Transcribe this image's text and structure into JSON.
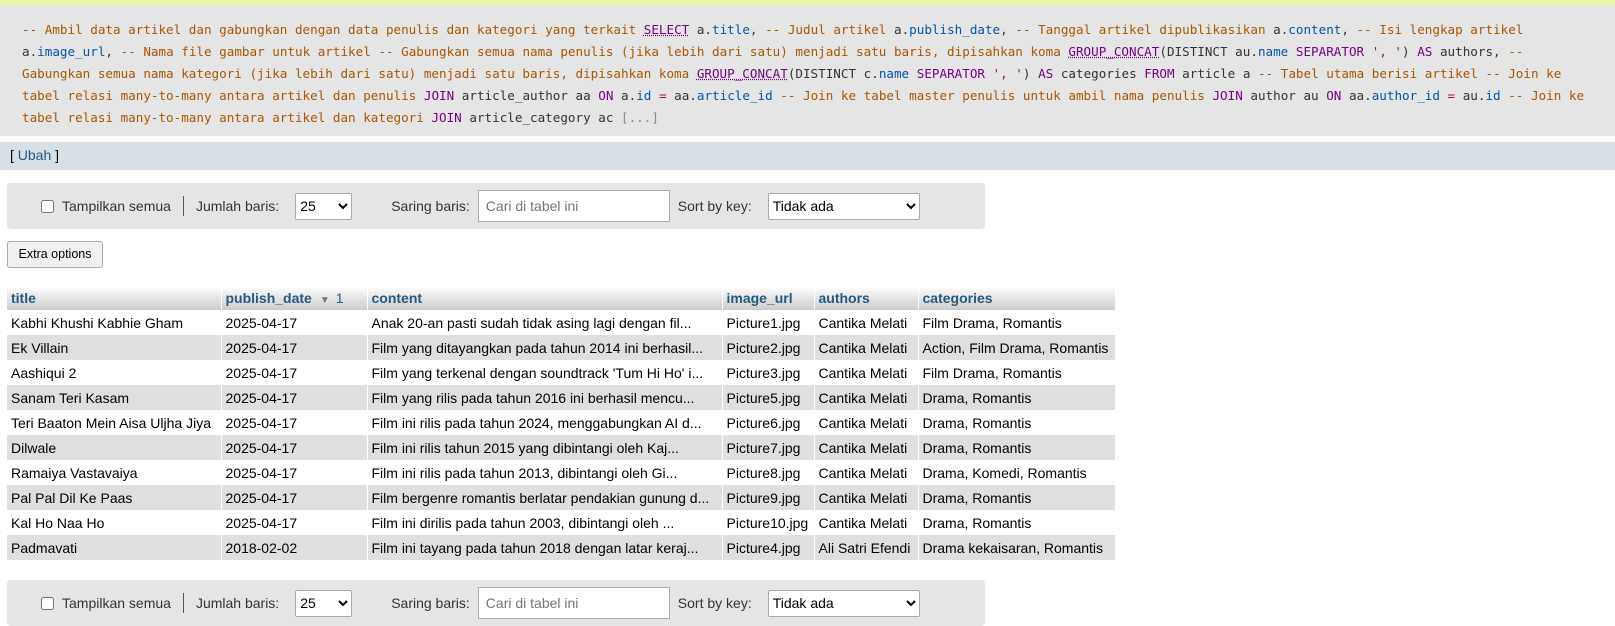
{
  "sql": {
    "segments": [
      {
        "c": "cm",
        "t": "-- Ambil data artikel dan gabungkan dengan data penulis dan kategori yang terkait "
      },
      {
        "c": "kw u",
        "t": "SELECT"
      },
      {
        "c": "plain",
        "t": " a."
      },
      {
        "c": "prop",
        "t": "title"
      },
      {
        "c": "plain",
        "t": ", "
      },
      {
        "c": "cm",
        "t": "-- Judul artikel "
      },
      {
        "c": "plain",
        "t": "a."
      },
      {
        "c": "prop",
        "t": "publish_date"
      },
      {
        "c": "plain",
        "t": ", "
      },
      {
        "c": "cm",
        "t": "-- Tanggal artikel dipublikasikan "
      },
      {
        "c": "plain",
        "t": "a."
      },
      {
        "c": "prop",
        "t": "content"
      },
      {
        "c": "plain",
        "t": ", "
      },
      {
        "c": "cm",
        "t": "-- Isi lengkap artikel "
      },
      {
        "c": "plain",
        "t": "a."
      },
      {
        "c": "prop",
        "t": "image_url"
      },
      {
        "c": "plain",
        "t": ", "
      },
      {
        "c": "cm",
        "t": "-- Nama file gambar untuk artikel -- Gabungkan semua nama penulis (jika lebih dari satu) menjadi satu baris, dipisahkan koma "
      },
      {
        "c": "kw u",
        "t": "GROUP_CONCAT"
      },
      {
        "c": "plain",
        "t": "(DISTINCT au."
      },
      {
        "c": "prop",
        "t": "name"
      },
      {
        "c": "kw",
        "t": " SEPARATOR "
      },
      {
        "c": "op",
        "t": "', '"
      },
      {
        "c": "plain",
        "t": ") "
      },
      {
        "c": "kw",
        "t": "AS"
      },
      {
        "c": "plain",
        "t": " authors, "
      },
      {
        "c": "cm",
        "t": "-- Gabungkan semua nama kategori (jika lebih dari satu) menjadi satu baris, dipisahkan koma "
      },
      {
        "c": "kw u",
        "t": "GROUP_CONCAT"
      },
      {
        "c": "plain",
        "t": "(DISTINCT c."
      },
      {
        "c": "prop",
        "t": "name"
      },
      {
        "c": "kw",
        "t": " SEPARATOR "
      },
      {
        "c": "op",
        "t": "', '"
      },
      {
        "c": "plain",
        "t": ") "
      },
      {
        "c": "kw",
        "t": "AS"
      },
      {
        "c": "plain",
        "t": " categories "
      },
      {
        "c": "kw",
        "t": "FROM"
      },
      {
        "c": "plain",
        "t": " article a "
      },
      {
        "c": "cm",
        "t": "-- Tabel utama berisi artikel -- Join ke tabel relasi many-to-many antara artikel dan penulis "
      },
      {
        "c": "kw",
        "t": "JOIN"
      },
      {
        "c": "plain",
        "t": " article_author aa "
      },
      {
        "c": "kw",
        "t": "ON"
      },
      {
        "c": "plain",
        "t": " a."
      },
      {
        "c": "prop",
        "t": "id"
      },
      {
        "c": "op",
        "t": " = "
      },
      {
        "c": "plain",
        "t": "aa."
      },
      {
        "c": "prop",
        "t": "article_id"
      },
      {
        "c": "cm",
        "t": " -- Join ke tabel master penulis untuk ambil nama penulis "
      },
      {
        "c": "kw",
        "t": "JOIN"
      },
      {
        "c": "plain",
        "t": " author au "
      },
      {
        "c": "kw",
        "t": "ON"
      },
      {
        "c": "plain",
        "t": " aa."
      },
      {
        "c": "prop",
        "t": "author_id"
      },
      {
        "c": "op",
        "t": " = "
      },
      {
        "c": "plain",
        "t": "au."
      },
      {
        "c": "prop",
        "t": "id"
      },
      {
        "c": "cm",
        "t": " -- Join ke tabel relasi many-to-many antara artikel dan kategori "
      },
      {
        "c": "kw",
        "t": "JOIN"
      },
      {
        "c": "plain",
        "t": " article_category ac "
      },
      {
        "c": "more",
        "t": "[...]"
      }
    ]
  },
  "edit": {
    "open": "[ ",
    "link": "Ubah",
    "close": " ]"
  },
  "nav": {
    "show_all_label": "Tampilkan semua",
    "rows_label": "Jumlah baris:",
    "rows_value": "25",
    "filter_label": "Saring baris:",
    "filter_placeholder": "Cari di tabel ini",
    "sort_label": "Sort by key:",
    "sort_value": "Tidak ada"
  },
  "extra_options_label": "Extra options",
  "table": {
    "columns": [
      "title",
      "publish_date",
      "content",
      "image_url",
      "authors",
      "categories"
    ],
    "sort_number": "1",
    "rows": [
      [
        "Kabhi Khushi Kabhie Gham",
        "2025-04-17",
        "Anak 20-an pasti sudah tidak asing lagi dengan fil...",
        "Picture1.jpg",
        "Cantika Melati",
        "Film Drama, Romantis"
      ],
      [
        "Ek Villain",
        "2025-04-17",
        "Film yang ditayangkan pada tahun 2014 ini berhasil...",
        "Picture2.jpg",
        "Cantika Melati",
        "Action, Film Drama, Romantis"
      ],
      [
        "Aashiqui 2",
        "2025-04-17",
        "Film yang terkenal dengan soundtrack 'Tum Hi Ho' i...",
        "Picture3.jpg",
        "Cantika Melati",
        "Film Drama, Romantis"
      ],
      [
        "Sanam Teri Kasam",
        "2025-04-17",
        "Film yang rilis pada tahun 2016 ini berhasil mencu...",
        "Picture5.jpg",
        "Cantika Melati",
        "Drama, Romantis"
      ],
      [
        "Teri Baaton Mein Aisa Uljha Jiya",
        "2025-04-17",
        "Film ini rilis pada tahun 2024, menggabungkan AI d...",
        "Picture6.jpg",
        "Cantika Melati",
        "Drama, Romantis"
      ],
      [
        "Dilwale",
        "2025-04-17",
        "Film ini rilis tahun 2015 yang dibintangi oleh Kaj...",
        "Picture7.jpg",
        "Cantika Melati",
        "Drama, Romantis"
      ],
      [
        "Ramaiya Vastavaiya",
        "2025-04-17",
        "Film ini rilis pada tahun 2013, dibintangi oleh Gi...",
        "Picture8.jpg",
        "Cantika Melati",
        "Drama, Komedi, Romantis"
      ],
      [
        "Pal Pal Dil Ke Paas",
        "2025-04-17",
        "Film bergenre romantis berlatar pendakian gunung d...",
        "Picture9.jpg",
        "Cantika Melati",
        "Drama, Romantis"
      ],
      [
        "Kal Ho Naa Ho",
        "2025-04-17",
        "Film ini dirilis pada tahun 2003, dibintangi oleh ...",
        "Picture10.jpg",
        "Cantika Melati",
        "Drama, Romantis"
      ],
      [
        "Padmavati",
        "2018-02-02",
        "Film ini tayang pada tahun 2018 dengan latar keraj...",
        "Picture4.jpg",
        "Ali Satri Efendi",
        "Drama kekaisaran, Romantis"
      ]
    ]
  }
}
